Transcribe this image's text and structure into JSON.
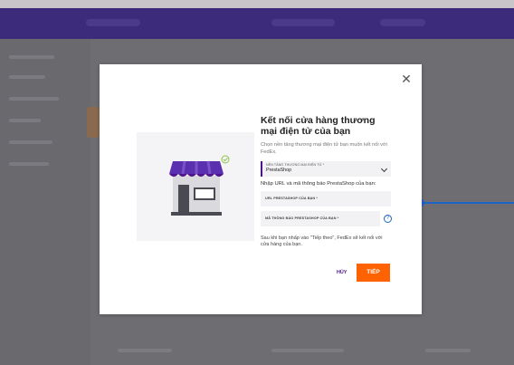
{
  "modal": {
    "title": "Kết nối cửa hàng thương mại điện tử của bạn",
    "subtitle": "Chọn nền tảng thương mại điện tử bạn muốn kết nối với FedEx.",
    "platform_select": {
      "label": "NỀN TẢNG THƯƠNG MẠI ĐIỆN TỬ *",
      "value": "PrestaShop"
    },
    "instruction": "Nhập URL và mã thông báo PrestaShop của bạn:",
    "url_field": {
      "placeholder": "URL PRESTASHOP CỦA BẠN *"
    },
    "token_field": {
      "placeholder": "MÃ THÔNG BÁO PRESTASHOP CỦA BẠN *"
    },
    "note": "Sau khi bạn nhấp vào \"Tiếp theo\", FedEx sẽ kết nối với cửa hàng của bạn.",
    "cancel_label": "HỦY",
    "next_label": "TIẾP",
    "close_glyph": "✕",
    "info_glyph": "?"
  },
  "colors": {
    "brand_purple": "#4d148c",
    "brand_orange": "#ff6200",
    "accent_blue": "#1e64c8",
    "awning_purple": "#5a2fb0",
    "check_green": "#8bc34a"
  },
  "icons": {
    "close": "close-icon",
    "chevron": "chevron-down-icon",
    "info": "info-icon",
    "storefront": "storefront-illustration",
    "check": "check-circle-icon"
  }
}
